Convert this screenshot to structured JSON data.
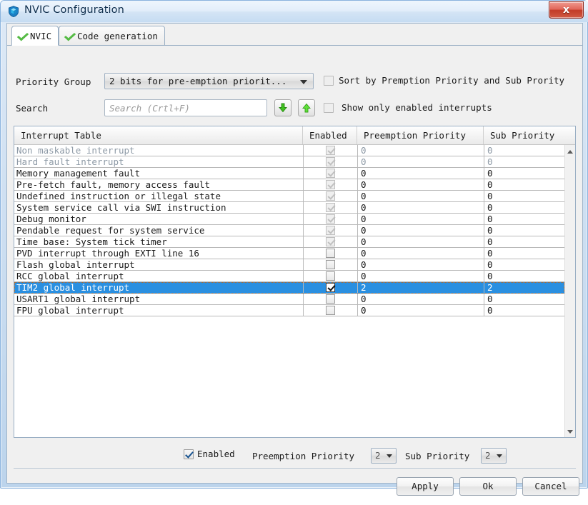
{
  "window": {
    "title": "NVIC Configuration",
    "icon": "shield-cube-icon",
    "close_label": "x"
  },
  "tabs": [
    {
      "label": "NVIC",
      "icon": "green-check-icon",
      "active": true
    },
    {
      "label": "Code generation",
      "icon": "green-check-icon",
      "active": false
    }
  ],
  "toolbar": {
    "priority_group_label": "Priority Group",
    "priority_group_value": "2 bits for pre-emption priorit...",
    "search_label": "Search",
    "search_value": "",
    "search_placeholder": "Search (Crtl+F)",
    "search_next_icon": "arrow-down-icon",
    "search_prev_icon": "arrow-up-icon",
    "sort_checkbox_label": "Sort by Premption Priority and Sub Prority",
    "sort_checkbox_checked": false,
    "show_enabled_checkbox_label": "Show only enabled interrupts",
    "show_enabled_checkbox_checked": false
  },
  "table": {
    "columns": [
      "Interrupt Table",
      "Enabled",
      "Preemption Priority",
      "Sub Priority"
    ],
    "rows": [
      {
        "name": "Non maskable interrupt",
        "enabled": true,
        "locked": true,
        "preemption": "0",
        "sub": "0",
        "dim": true,
        "selected": false
      },
      {
        "name": "Hard fault interrupt",
        "enabled": true,
        "locked": true,
        "preemption": "0",
        "sub": "0",
        "dim": true,
        "selected": false
      },
      {
        "name": "Memory management fault",
        "enabled": true,
        "locked": true,
        "preemption": "0",
        "sub": "0",
        "dim": false,
        "selected": false
      },
      {
        "name": "Pre-fetch fault, memory access fault",
        "enabled": true,
        "locked": true,
        "preemption": "0",
        "sub": "0",
        "dim": false,
        "selected": false
      },
      {
        "name": "Undefined instruction or illegal state",
        "enabled": true,
        "locked": true,
        "preemption": "0",
        "sub": "0",
        "dim": false,
        "selected": false
      },
      {
        "name": "System service call via SWI instruction",
        "enabled": true,
        "locked": true,
        "preemption": "0",
        "sub": "0",
        "dim": false,
        "selected": false
      },
      {
        "name": "Debug monitor",
        "enabled": true,
        "locked": true,
        "preemption": "0",
        "sub": "0",
        "dim": false,
        "selected": false
      },
      {
        "name": "Pendable request for system service",
        "enabled": true,
        "locked": true,
        "preemption": "0",
        "sub": "0",
        "dim": false,
        "selected": false
      },
      {
        "name": "Time base: System tick timer",
        "enabled": true,
        "locked": true,
        "preemption": "0",
        "sub": "0",
        "dim": false,
        "selected": false
      },
      {
        "name": "PVD interrupt through EXTI line 16",
        "enabled": false,
        "locked": false,
        "preemption": "0",
        "sub": "0",
        "dim": false,
        "selected": false
      },
      {
        "name": "Flash global interrupt",
        "enabled": false,
        "locked": false,
        "preemption": "0",
        "sub": "0",
        "dim": false,
        "selected": false
      },
      {
        "name": "RCC global interrupt",
        "enabled": false,
        "locked": false,
        "preemption": "0",
        "sub": "0",
        "dim": false,
        "selected": false
      },
      {
        "name": "TIM2 global interrupt",
        "enabled": true,
        "locked": false,
        "preemption": "2",
        "sub": "2",
        "dim": false,
        "selected": true
      },
      {
        "name": "USART1 global interrupt",
        "enabled": false,
        "locked": false,
        "preemption": "0",
        "sub": "0",
        "dim": false,
        "selected": false
      },
      {
        "name": "FPU global interrupt",
        "enabled": false,
        "locked": false,
        "preemption": "0",
        "sub": "0",
        "dim": false,
        "selected": false
      }
    ],
    "scroll_up_icon": "triangle-up-icon",
    "scroll_down_icon": "triangle-down-icon"
  },
  "editor": {
    "enabled_label": "Enabled",
    "enabled_checked": true,
    "preemption_label": "Preemption Priority",
    "preemption_value": "2",
    "sub_label": "Sub Priority",
    "sub_value": "2"
  },
  "footer": {
    "apply": "Apply",
    "ok": "Ok",
    "cancel": "Cancel"
  },
  "colors": {
    "selection": "#2a8fe0",
    "check_green": "#55bb44",
    "close_red": "#c23b27",
    "title_blue": "#11304e"
  }
}
